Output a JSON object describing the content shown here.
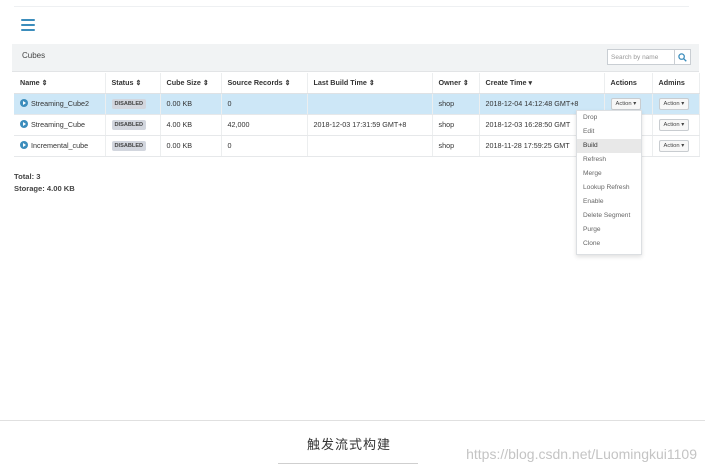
{
  "panel": {
    "title": "Cubes",
    "search_placeholder": "Search by name"
  },
  "table": {
    "columns": [
      "Name ⇕",
      "Status ⇕",
      "Cube Size ⇕",
      "Source Records ⇕",
      "Last Build Time ⇕",
      "Owner ⇕",
      "Create Time ▾",
      "Actions",
      "Admins"
    ],
    "rows": [
      {
        "name": "Streaming_Cube2",
        "status": "DISABLED",
        "size": "0.00 KB",
        "records": "0",
        "last_build": "",
        "owner": "shop",
        "create_time": "2018-12-04 14:12:48 GMT+8",
        "action": "Action ▾",
        "admin": "Action ▾"
      },
      {
        "name": "Streaming_Cube",
        "status": "DISABLED",
        "size": "4.00 KB",
        "records": "42,000",
        "last_build": "2018-12-03 17:31:59 GMT+8",
        "owner": "shop",
        "create_time": "2018-12-03 16:28:50 GMT",
        "action": "",
        "admin": "Action ▾"
      },
      {
        "name": "Incremental_cube",
        "status": "DISABLED",
        "size": "0.00 KB",
        "records": "0",
        "last_build": "",
        "owner": "shop",
        "create_time": "2018-11-28 17:59:25 GMT",
        "action": "",
        "admin": "Action ▾"
      }
    ]
  },
  "menu": {
    "items": [
      "Drop",
      "Edit",
      "Build",
      "Refresh",
      "Merge",
      "Lookup Refresh",
      "Enable",
      "Delete Segment",
      "Purge",
      "Clone"
    ],
    "active_index": 2
  },
  "totals": {
    "total": "Total: 3",
    "storage": "Storage: 4.00 KB"
  },
  "caption": "触发流式构建",
  "watermark": "https://blog.csdn.net/Luomingkui1109",
  "colors": {
    "accent": "#3c8dbc",
    "selected_row": "#cde7f7",
    "badge": "#d2d6de"
  },
  "icons": {
    "menu": "hamburger-icon",
    "search": "search-icon",
    "row": "chevron-right-circle-icon"
  }
}
